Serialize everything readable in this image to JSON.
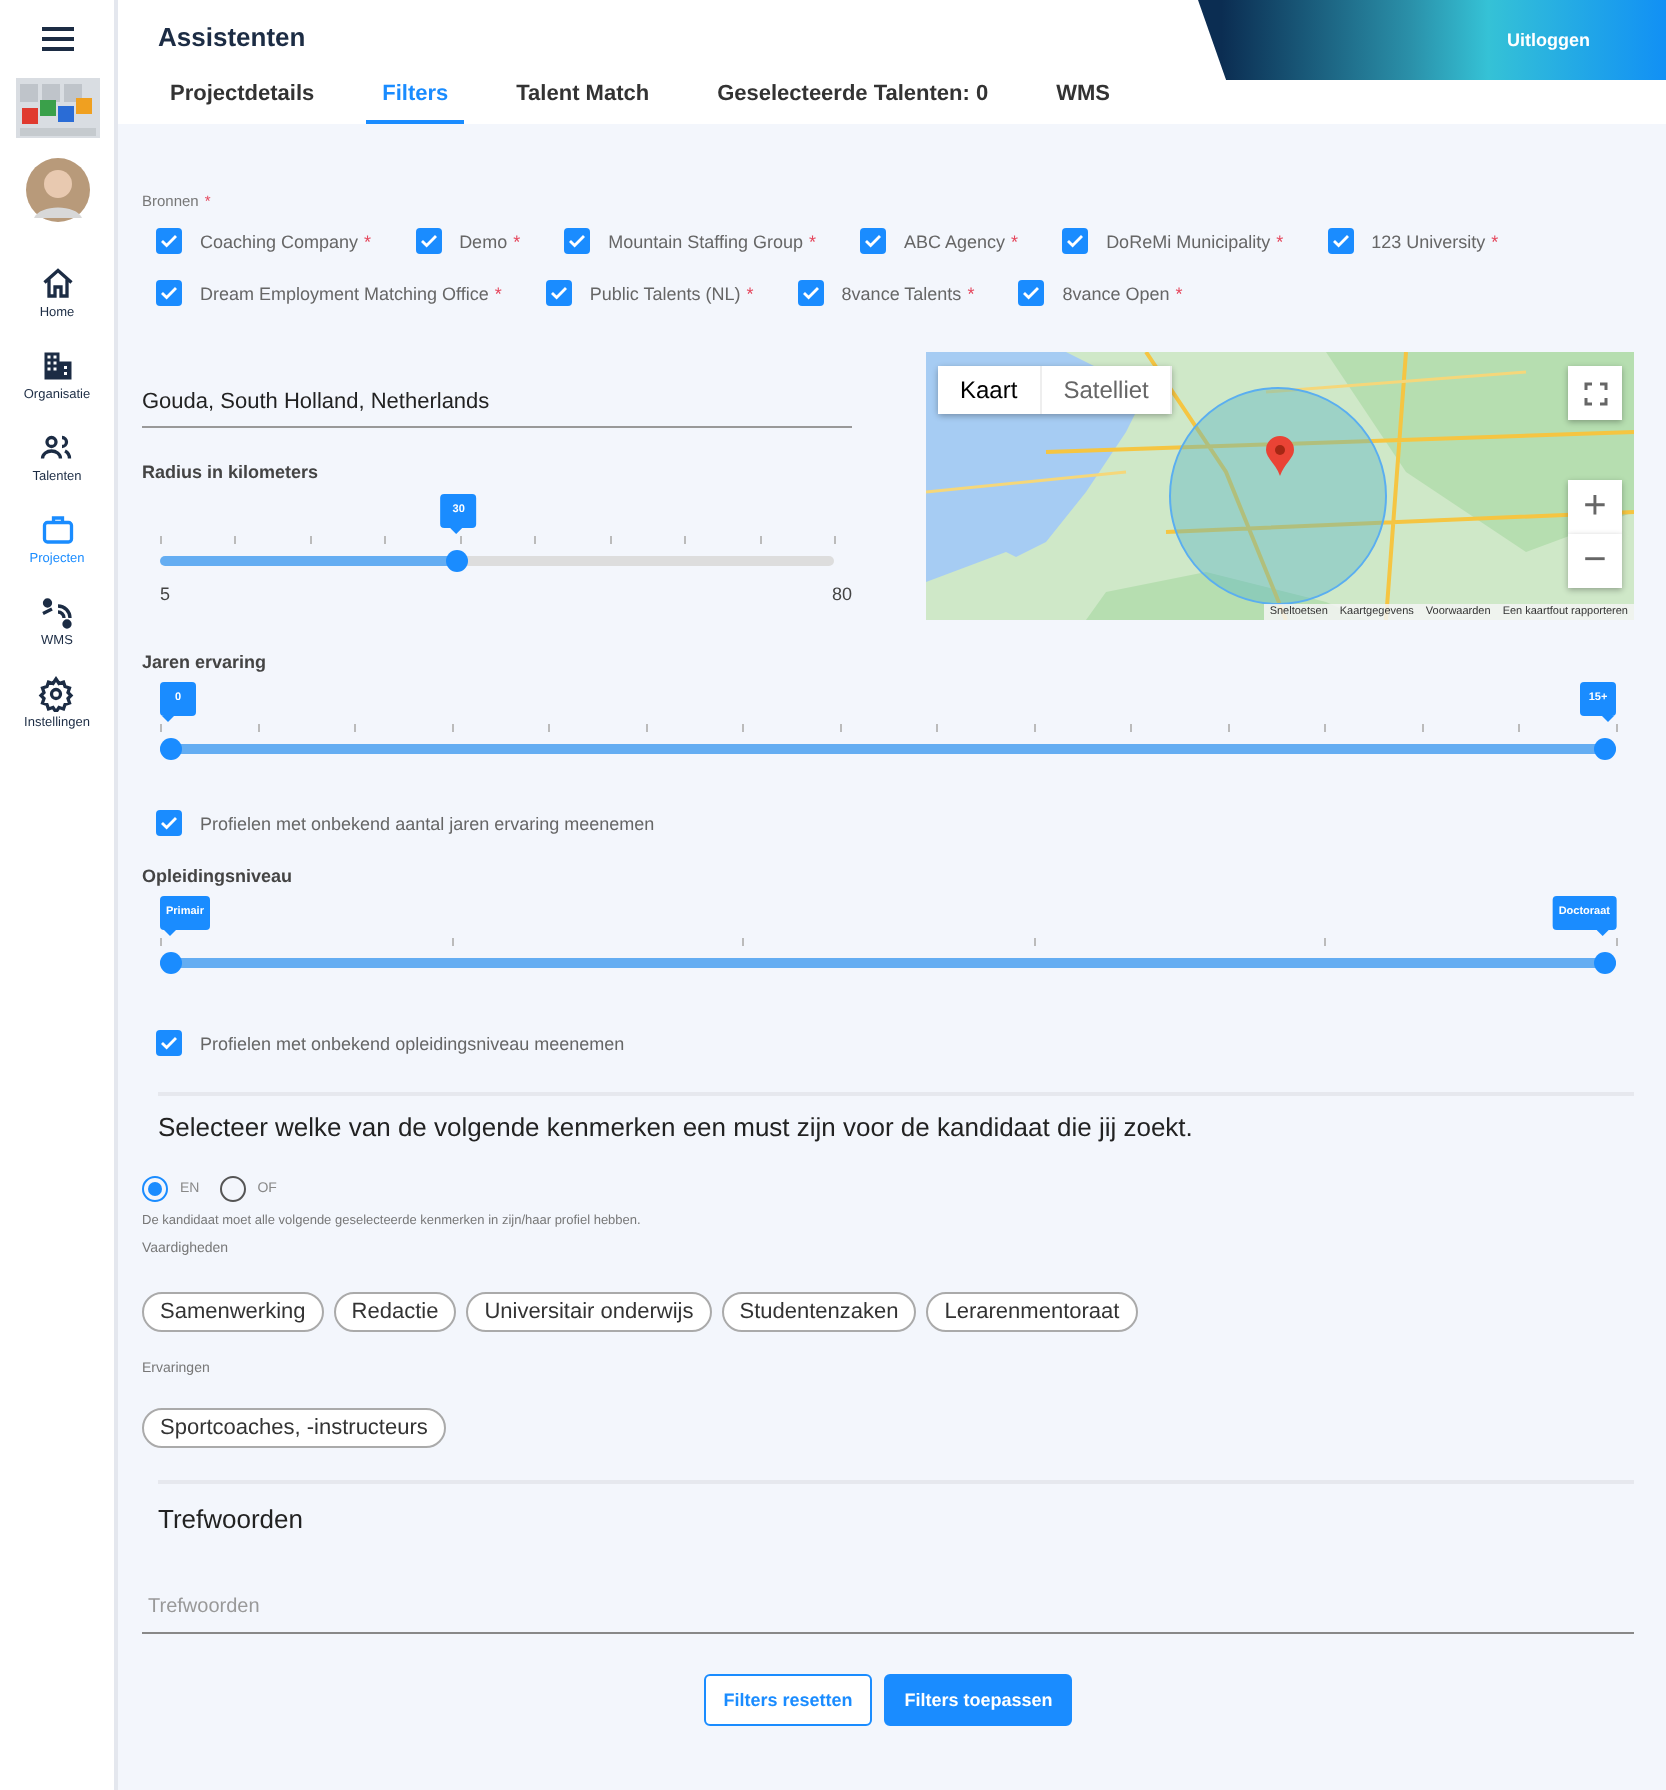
{
  "sidebar": {
    "items": [
      {
        "label": "Home",
        "selected": false
      },
      {
        "label": "Organisatie",
        "selected": false
      },
      {
        "label": "Talenten",
        "selected": false
      },
      {
        "label": "Projecten",
        "selected": true
      },
      {
        "label": "WMS",
        "selected": false
      },
      {
        "label": "Instellingen",
        "selected": false
      }
    ]
  },
  "header": {
    "title": "Assistenten",
    "logout": "Uitloggen"
  },
  "tabs": [
    {
      "label": "Projectdetails",
      "selected": false
    },
    {
      "label": "Filters",
      "selected": true
    },
    {
      "label": "Talent Match",
      "selected": false
    },
    {
      "label": "Geselecteerde Talenten: 0",
      "selected": false
    },
    {
      "label": "WMS",
      "selected": false
    }
  ],
  "sources": {
    "label": "Bronnen",
    "required": "*",
    "items": [
      {
        "label": "Coaching Company",
        "checked": true
      },
      {
        "label": "Demo",
        "checked": true
      },
      {
        "label": "Mountain Staffing Group",
        "checked": true
      },
      {
        "label": "ABC Agency",
        "checked": true
      },
      {
        "label": "DoReMi Municipality",
        "checked": true
      },
      {
        "label": "123 University",
        "checked": true
      },
      {
        "label": "Dream Employment Matching Office",
        "checked": true
      },
      {
        "label": "Public Talents (NL)",
        "checked": true
      },
      {
        "label": "8vance Talents",
        "checked": true
      },
      {
        "label": "8vance Open",
        "checked": true
      }
    ]
  },
  "location": {
    "value": "Gouda, South Holland, Netherlands"
  },
  "map": {
    "kind": "picture",
    "map_types": [
      {
        "label": "Kaart",
        "selected": true
      },
      {
        "label": "Satelliet",
        "selected": false
      }
    ],
    "zoom_in": "+",
    "zoom_out": "−",
    "footer": [
      "Sneltoetsen",
      "Kaartgegevens",
      "Voorwaarden",
      "Een kaartfout rapporteren"
    ]
  },
  "radius": {
    "label": "Radius in kilometers",
    "thumbs": [
      {
        "label": "30",
        "level": 0.44
      }
    ],
    "min": "5",
    "max": "80"
  },
  "experience": {
    "label": "Jaren ervaring",
    "thumbs": [
      {
        "label": "0",
        "level": 0
      },
      {
        "label": "15+",
        "level": 1
      }
    ],
    "unknown": {
      "label": "Profielen met onbekend aantal jaren ervaring meenemen",
      "checked": true
    }
  },
  "education": {
    "label": "Opleidingsniveau",
    "thumbs": [
      {
        "label": "Primair",
        "level": 0
      },
      {
        "label": "Doctoraat",
        "level": 1
      }
    ],
    "unknown": {
      "label": "Profielen met onbekend opleidingsniveau meenemen",
      "checked": true
    }
  },
  "must": {
    "heading": "Selecteer welke van de volgende kenmerken een must zijn voor de kandidaat die jij zoekt.",
    "options": [
      {
        "label": "EN",
        "selected": true
      },
      {
        "label": "OF",
        "selected": false
      }
    ],
    "hint": "De kandidaat moet alle volgende geselecteerde kenmerken in zijn/haar profiel hebben.",
    "groups": [
      {
        "label": "Vaardigheden",
        "chips": [
          "Samenwerking",
          "Redactie",
          "Universitair onderwijs",
          "Studentenzaken",
          "Lerarenmentoraat"
        ]
      },
      {
        "label": "Ervaringen",
        "chips": [
          "Sportcoaches, -instructeurs"
        ]
      }
    ]
  },
  "keywords": {
    "heading": "Trefwoorden",
    "placeholder": "Trefwoorden"
  },
  "buttons": [
    {
      "label": "Filters resetten",
      "kind": "outline"
    },
    {
      "label": "Filters toepassen",
      "kind": "primary"
    }
  ]
}
